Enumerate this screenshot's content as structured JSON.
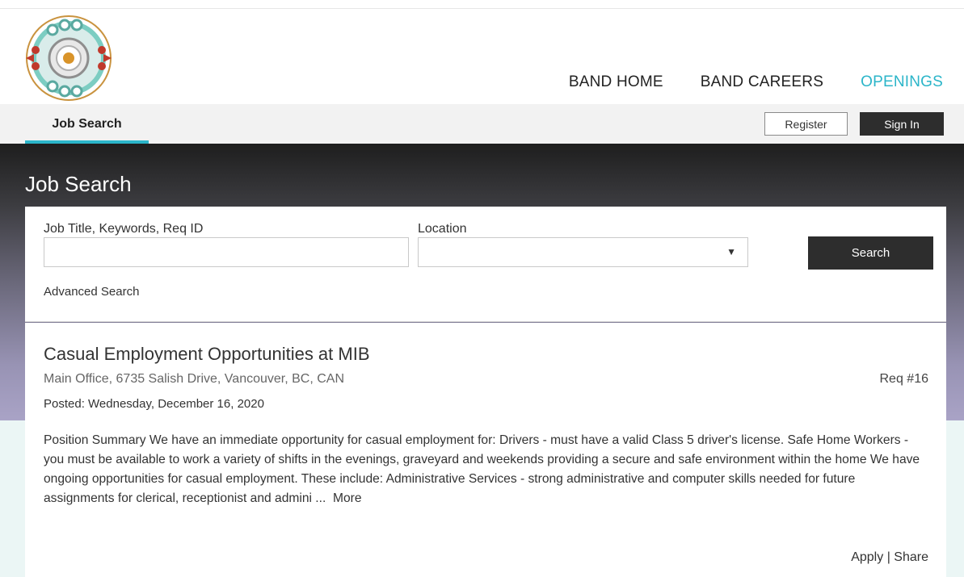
{
  "header": {
    "nav": [
      {
        "label": "BAND HOME",
        "active": false
      },
      {
        "label": "BAND CAREERS",
        "active": false
      },
      {
        "label": "OPENINGS",
        "active": true
      }
    ],
    "accent_color": "#2bb5c9"
  },
  "subnav": {
    "tab_label": "Job Search",
    "register_label": "Register",
    "signin_label": "Sign In"
  },
  "search": {
    "page_title": "Job Search",
    "keywords_label": "Job Title, Keywords, Req ID",
    "keywords_value": "",
    "location_label": "Location",
    "location_value": "",
    "search_label": "Search",
    "advanced_label": "Advanced Search"
  },
  "results": [
    {
      "title": "Casual Employment Opportunities at MIB",
      "location": "Main Office, 6735 Salish Drive, Vancouver, BC, CAN",
      "req": "Req #16",
      "posted": "Posted: Wednesday, December 16, 2020",
      "summary": "Position Summary We have an immediate opportunity for casual employment for: Drivers - must have a valid Class 5 driver's license. Safe Home Workers - you must be available to work a variety of shifts in the evenings, graveyard and weekends providing a secure and safe environment within the home We have ongoing opportunities for casual employment. These include: Administrative Services - strong administrative and computer skills needed for future assignments for clerical, receptionist and admini ...",
      "more_label": "More",
      "apply_label": "Apply",
      "separator": "|",
      "share_label": "Share"
    }
  ]
}
